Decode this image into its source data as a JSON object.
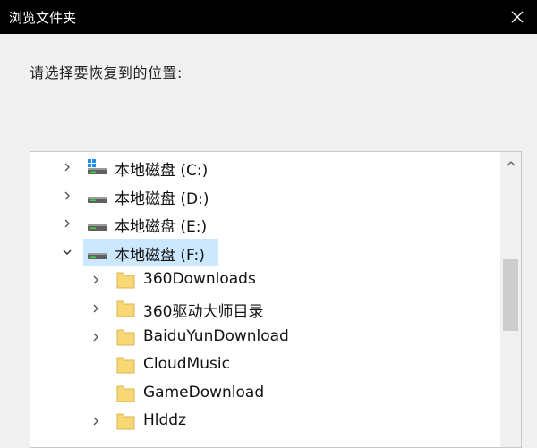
{
  "window": {
    "title": "浏览文件夹"
  },
  "dialog": {
    "prompt": "请选择要恢复到的位置:"
  },
  "icons": {
    "close": "close-icon",
    "expand": "chevron-right-icon",
    "collapse": "chevron-down-icon",
    "system_drive": "system-drive-icon",
    "drive": "drive-icon",
    "folder": "folder-icon",
    "scroll_up": "scroll-up-arrow-icon"
  },
  "colors": {
    "titlebar": "#000000",
    "selection": "#cce8ff",
    "folder": "#f8d775",
    "windows_blue": "#1e8ee8"
  },
  "tree": {
    "items": [
      {
        "label": "本地磁盘 (C:)",
        "type": "system-drive",
        "expander": "collapsed",
        "level": 0
      },
      {
        "label": "本地磁盘 (D:)",
        "type": "drive",
        "expander": "collapsed",
        "level": 0
      },
      {
        "label": "本地磁盘 (E:)",
        "type": "drive",
        "expander": "collapsed",
        "level": 0
      },
      {
        "label": "本地磁盘 (F:)",
        "type": "drive",
        "expander": "expanded",
        "level": 0,
        "selected": true
      },
      {
        "label": "360Downloads",
        "type": "folder",
        "expander": "collapsed",
        "level": 1
      },
      {
        "label": "360驱动大师目录",
        "type": "folder",
        "expander": "collapsed",
        "level": 1
      },
      {
        "label": "BaiduYunDownload",
        "type": "folder",
        "expander": "collapsed",
        "level": 1
      },
      {
        "label": "CloudMusic",
        "type": "folder",
        "expander": "none",
        "level": 1
      },
      {
        "label": "GameDownload",
        "type": "folder",
        "expander": "none",
        "level": 1
      },
      {
        "label": "Hlddz",
        "type": "folder",
        "expander": "collapsed",
        "level": 1
      }
    ]
  }
}
